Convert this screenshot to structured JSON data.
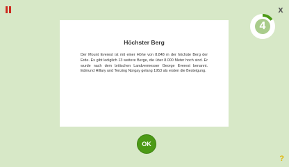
{
  "controls": {
    "close_label": "x",
    "help_label": "?",
    "ok_label": "OK"
  },
  "counter": {
    "value": "4",
    "progress_fraction": 0.15
  },
  "card": {
    "title": "Höchster Berg",
    "body": "Der Mount Everest ist mit einer Höhe von 8.848 m der höchste Berg der Erde. Es gibt lediglich 13 weitere Berge, die über 8.000 Meter hoch sind. Er wurde nach dem britischen Landvermesser George Everest benannt. Edmund Hillary und Tenzing Norgay gelang 1953 als ersten die Besteigung."
  },
  "colors": {
    "background": "#d7e8c7",
    "pause": "#cc2a1e",
    "ok_button": "#4c9a16",
    "counter_ring": "#4c9a16",
    "counter_fill": "#a9cc8c",
    "help": "#e0b400"
  }
}
